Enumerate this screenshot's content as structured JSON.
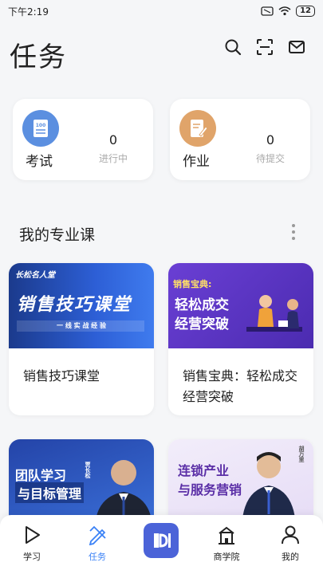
{
  "status_bar": {
    "time": "下午2:19",
    "battery": "12"
  },
  "header": {
    "title": "任务"
  },
  "stats": [
    {
      "label": "考试",
      "value": "0",
      "sub": "进行中",
      "color": "#5b8fe0"
    },
    {
      "label": "作业",
      "value": "0",
      "sub": "待提交",
      "color": "#e0a46a"
    }
  ],
  "section": {
    "title": "我的专业课"
  },
  "courses": [
    {
      "name": "销售技巧课堂",
      "cover_title": "销售技巧课堂",
      "cover_sub": "一 线 实 战 经 验",
      "cover_tag": "长松名人堂"
    },
    {
      "name": "销售宝典：轻松成交经营突破",
      "cover_tag": "销售宝典:",
      "cover_title_1": "轻松成交",
      "cover_title_2": "经营突破"
    },
    {
      "name": "",
      "cover_title_1": "团队学习",
      "cover_title_2": "与目标管理",
      "cover_person": "贾长松"
    },
    {
      "name": "",
      "cover_title_1": "连锁产业",
      "cover_title_2": "与服务营销",
      "cover_person": "胡万里"
    }
  ],
  "tabs": [
    {
      "label": "学习"
    },
    {
      "label": "任务"
    },
    {
      "label": "商学院"
    },
    {
      "label": "我的"
    }
  ],
  "colors": {
    "accent": "#3b82f6",
    "brand": "#4b63d8"
  }
}
